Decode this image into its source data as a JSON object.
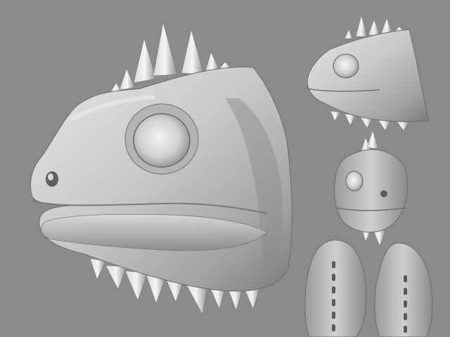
{
  "scene": {
    "background": "#8b8b8b",
    "surface_light": "#f2f2f2",
    "surface_mid": "#c4c4c4",
    "surface_dark": "#6e6e6e",
    "views": [
      {
        "label": "main-three-quarter-view"
      },
      {
        "label": "side-profile-view"
      },
      {
        "label": "front-three-quarter-view"
      },
      {
        "label": "bottom-view"
      },
      {
        "label": "top-view"
      }
    ]
  }
}
